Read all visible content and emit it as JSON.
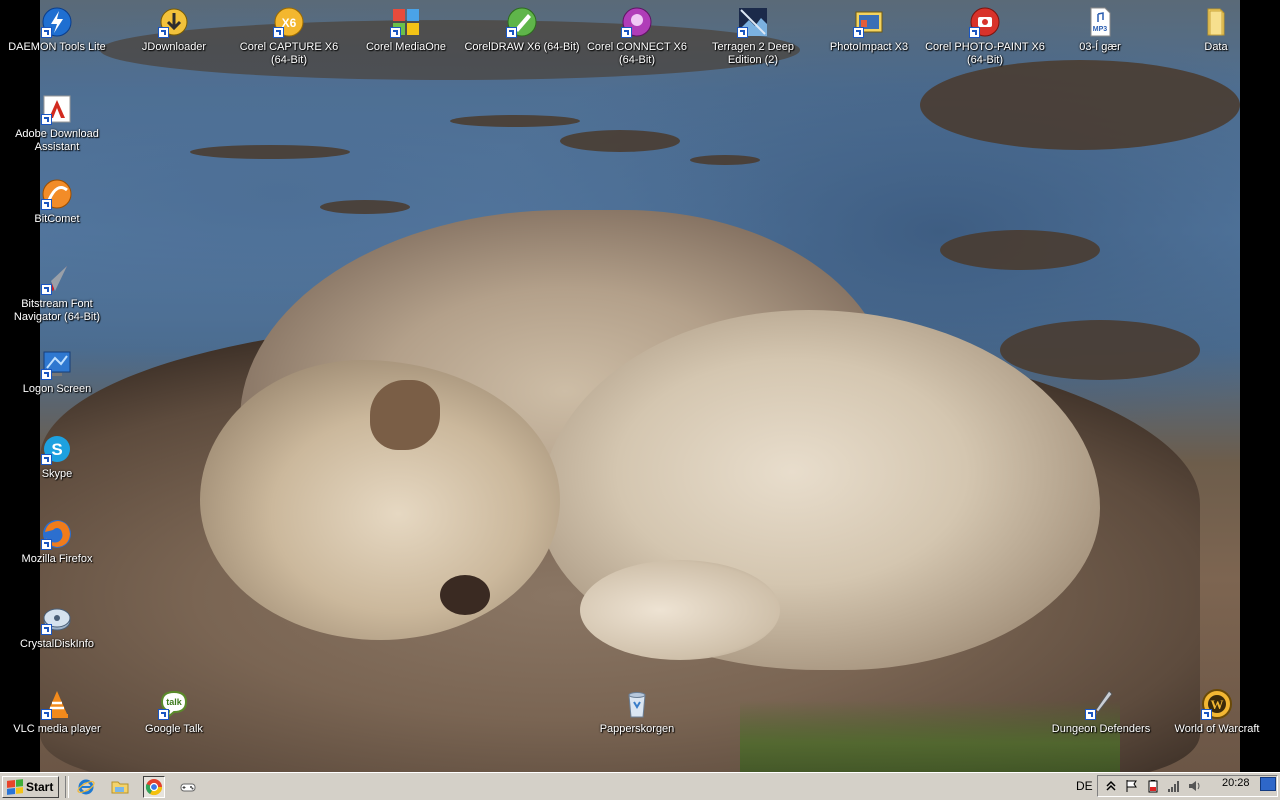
{
  "desktop": {
    "icons": [
      {
        "label": "DAEMON Tools Lite",
        "icon": "daemon-tools-icon"
      },
      {
        "label": "JDownloader",
        "icon": "jdownloader-icon"
      },
      {
        "label": "Corel CAPTURE X6\n(64-Bit)",
        "icon": "corel-capture-icon"
      },
      {
        "label": "Corel MediaOne",
        "icon": "corel-mediaone-icon"
      },
      {
        "label": "CorelDRAW X6 (64-Bit)",
        "icon": "coreldraw-icon"
      },
      {
        "label": "Corel CONNECT X6\n(64-Bit)",
        "icon": "corel-connect-icon"
      },
      {
        "label": "Terragen 2 Deep\nEdition (2)",
        "icon": "terragen-icon"
      },
      {
        "label": "PhotoImpact X3",
        "icon": "photoimpact-icon"
      },
      {
        "label": "Corel PHOTO-PAINT X6\n(64-Bit)",
        "icon": "corel-photopaint-icon"
      },
      {
        "label": "03-Í gær",
        "icon": "mp3-file-icon"
      },
      {
        "label": "Data",
        "icon": "folder-icon"
      },
      {
        "label": "Adobe Download\nAssistant",
        "icon": "adobe-download-icon"
      },
      {
        "label": "BitComet",
        "icon": "bitcomet-icon"
      },
      {
        "label": "Bitstream Font\nNavigator (64-Bit)",
        "icon": "font-navigator-icon"
      },
      {
        "label": "Logon Screen",
        "icon": "logon-screen-icon"
      },
      {
        "label": "Skype",
        "icon": "skype-icon"
      },
      {
        "label": "Mozilla Firefox",
        "icon": "firefox-icon"
      },
      {
        "label": "CrystalDiskInfo",
        "icon": "crystaldiskinfo-icon"
      },
      {
        "label": "VLC media player",
        "icon": "vlc-icon"
      },
      {
        "label": "Google Talk",
        "icon": "google-talk-icon"
      },
      {
        "label": "Papperskorgen",
        "icon": "recycle-bin-icon"
      },
      {
        "label": "Dungeon Defenders",
        "icon": "dungeon-defenders-icon"
      },
      {
        "label": "World of Warcraft",
        "icon": "world-of-warcraft-icon"
      }
    ]
  },
  "taskbar": {
    "start_label": "Start",
    "language": "DE",
    "clock": "20:28",
    "quick_launch": [
      "internet-explorer-icon",
      "explorer-folder-icon",
      "chrome-icon",
      "gamepad-icon"
    ],
    "tray": [
      "expand-arrow-icon",
      "action-center-flag-icon",
      "battery-icon",
      "network-icon",
      "volume-icon"
    ]
  },
  "colors": {
    "taskbar_bg": "#d4d0c8",
    "label_text": "#ffffff",
    "shortcut_arrow": "#1a56c2"
  }
}
